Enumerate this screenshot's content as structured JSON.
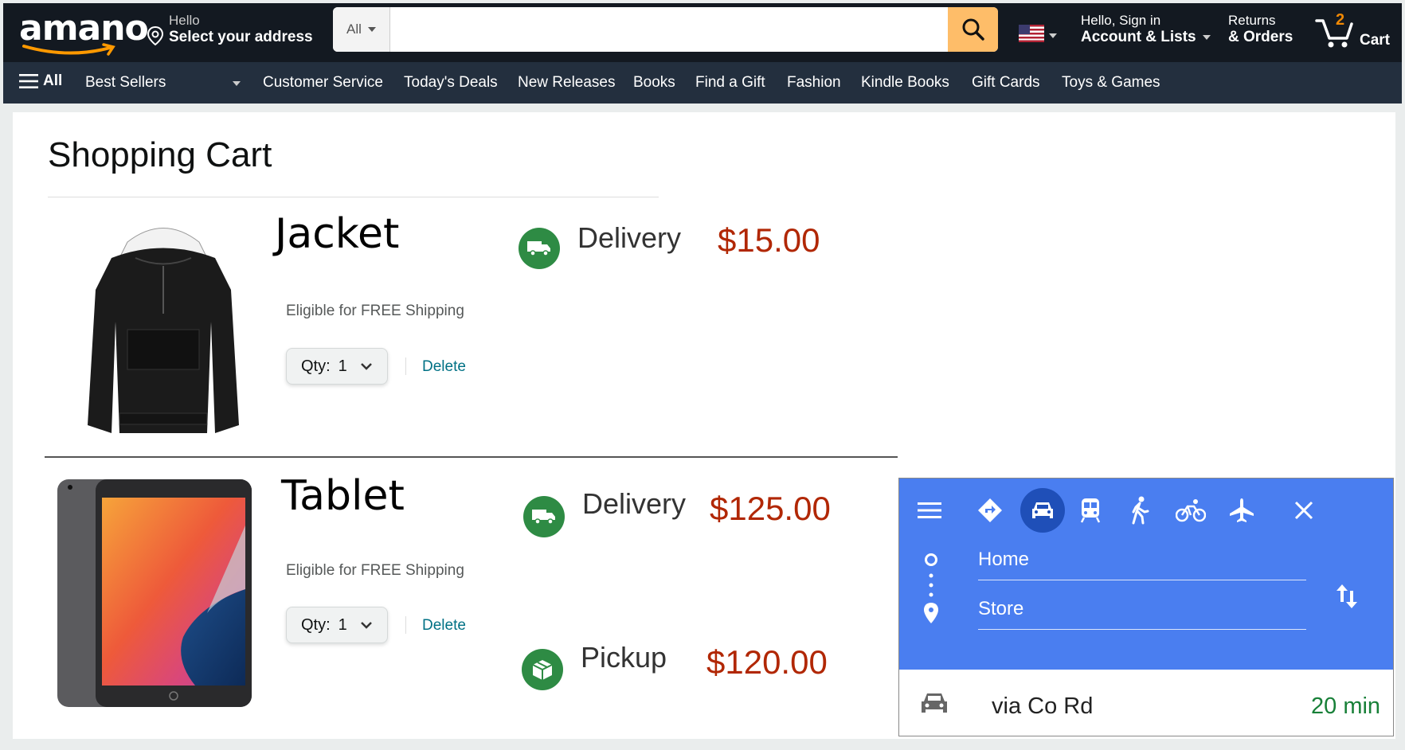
{
  "header": {
    "logo": "amano",
    "address_line1": "Hello",
    "address_line2": "Select your address",
    "search_category": "All",
    "search_placeholder": "",
    "account_line1": "Hello, Sign in",
    "account_line2": "Account & Lists",
    "returns_line1": "Returns",
    "returns_line2": "& Orders",
    "cart_count": "2",
    "cart_label": "Cart",
    "brand_color": "#131921",
    "accent_color": "#febd69"
  },
  "subnav": {
    "all_label": "All",
    "items": [
      "Best Sellers",
      "Customer Service",
      "Today's Deals",
      "New Releases",
      "Books",
      "Find a Gift",
      "Fashion",
      "Kindle Books",
      "Gift Cards",
      "Toys & Games"
    ]
  },
  "cart": {
    "title": "Shopping Cart",
    "items": [
      {
        "name": "Jacket",
        "shipping_note": "Eligible for FREE Shipping",
        "qty_label": "Qty:",
        "qty_value": "1",
        "delete_label": "Delete",
        "options": [
          {
            "mode": "Delivery",
            "price": "$15.00",
            "icon": "truck-icon"
          }
        ]
      },
      {
        "name": "Tablet",
        "shipping_note": "Eligible for FREE Shipping",
        "qty_label": "Qty:",
        "qty_value": "1",
        "delete_label": "Delete",
        "options": [
          {
            "mode": "Delivery",
            "price": "$125.00",
            "icon": "truck-icon"
          },
          {
            "mode": "Pickup",
            "price": "$120.00",
            "icon": "package-icon"
          }
        ]
      }
    ]
  },
  "maps": {
    "from": "Home",
    "to": "Store",
    "route_via": "via Co Rd",
    "route_time": "20 min",
    "selected_mode": "car-icon",
    "header_color": "#4a7ef0"
  }
}
